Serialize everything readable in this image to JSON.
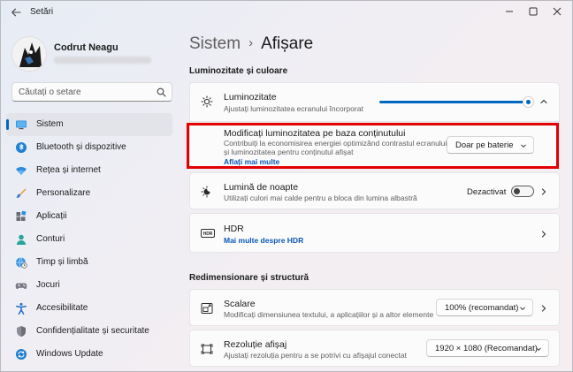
{
  "window": {
    "title": "Setări"
  },
  "user": {
    "name": "Codrut Neagu"
  },
  "search": {
    "placeholder": "Căutați o setare"
  },
  "sidebar": {
    "items": [
      {
        "label": "Sistem",
        "icon": "monitor-icon"
      },
      {
        "label": "Bluetooth și dispozitive",
        "icon": "bluetooth-icon"
      },
      {
        "label": "Rețea și internet",
        "icon": "wifi-icon"
      },
      {
        "label": "Personalizare",
        "icon": "paintbrush-icon"
      },
      {
        "label": "Aplicații",
        "icon": "apps-icon"
      },
      {
        "label": "Conturi",
        "icon": "person-icon"
      },
      {
        "label": "Timp și limbă",
        "icon": "globe-clock-icon"
      },
      {
        "label": "Jocuri",
        "icon": "gamepad-icon"
      },
      {
        "label": "Accesibilitate",
        "icon": "accessibility-icon"
      },
      {
        "label": "Confidențialitate și securitate",
        "icon": "shield-icon"
      },
      {
        "label": "Windows Update",
        "icon": "update-icon"
      }
    ],
    "active_index": 0
  },
  "breadcrumb": {
    "parent": "Sistem",
    "separator": "›",
    "current": "Afișare"
  },
  "sections": {
    "brightness_color": "Luminozitate și culoare",
    "scale_layout": "Redimensionare și structură"
  },
  "brightness": {
    "title": "Luminozitate",
    "subtitle": "Ajustați luminozitatea ecranului încorporat",
    "level": 1.0
  },
  "content_brightness": {
    "title": "Modificați luminozitatea pe baza conținutului",
    "subtitle_line1": "Contribuiți la economisirea energiei optimizând contrastul ecranului",
    "subtitle_line2": "și luminozitatea pentru conținutul afișat",
    "link": "Aflați mai multe",
    "value": "Doar pe baterie"
  },
  "night_light": {
    "title": "Lumină de noapte",
    "subtitle": "Utilizați culori mai calde pentru a bloca din lumina albastră",
    "state": "Dezactivat",
    "on": false
  },
  "hdr": {
    "title": "HDR",
    "link": "Mai multe despre HDR",
    "icon_text": "HDR"
  },
  "scale": {
    "title": "Scalare",
    "subtitle": "Modificați dimensiunea textului, a aplicațiilor și a altor elemente",
    "value": "100% (recomandat)"
  },
  "resolution": {
    "title": "Rezoluție afișaj",
    "subtitle": "Ajustați rezoluția pentru a se  potrivi cu afișajul conectat",
    "value": "1920 × 1080 (Recomandat)"
  },
  "colors": {
    "accent": "#0067c0",
    "highlight": "#e30000",
    "link": "#0a58b7"
  }
}
